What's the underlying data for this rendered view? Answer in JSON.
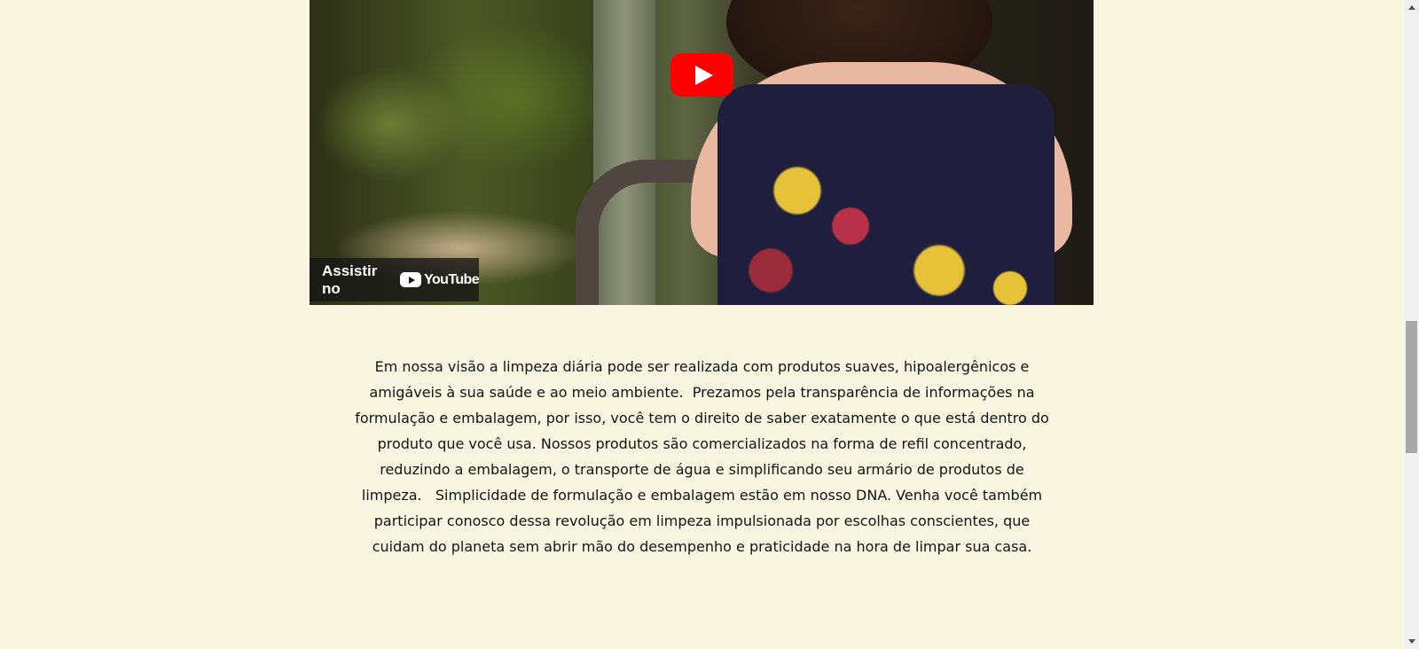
{
  "video": {
    "watch_on_label": "Assistir no",
    "youtube_wordmark": "YouTube",
    "play_button_color": "#ff0000",
    "icons": [
      "play-icon",
      "youtube-logo-icon"
    ]
  },
  "description": {
    "text": "Em nossa visão a limpeza diária pode ser realizada com produtos suaves, hipoalergênicos e amigáveis à sua saúde e ao meio ambiente.  Prezamos pela transparência de informações na formulação e embalagem, por isso, você tem o direito de saber exatamente o que está dentro do produto que você usa. Nossos produtos são comercializados na forma de refil concentrado, reduzindo a embalagem, o transporte de água e simplificando seu armário de produtos de limpeza.   Simplicidade de formulação e embalagem estão em nosso DNA. Venha você também participar conosco dessa revolução em limpeza impulsionada por escolhas conscientes, que cuidam do planeta sem abrir mão do desempenho e praticidade na hora de limpar sua casa."
  },
  "colors": {
    "page_background": "#f8f6e1",
    "text": "#141414"
  }
}
